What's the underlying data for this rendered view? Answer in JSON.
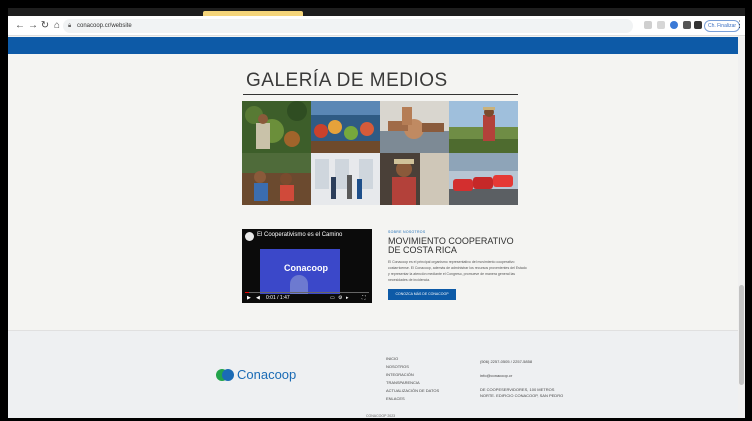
{
  "browser": {
    "url": "conacoop.cr/website",
    "profile_label": "Ch. Finalizar"
  },
  "gallery": {
    "title": "GALERÍA DE MEDIOS"
  },
  "video": {
    "title": "El Cooperativismo es el Camino",
    "logo": "Conacoop",
    "time": "0:01 / 1:47"
  },
  "info": {
    "eyebrow": "SOBRE NOSOTROS",
    "title_line1": "MOVIMIENTO COOPERATIVO",
    "title_line2": "DE COSTA RICA",
    "body": "El Conacoop es el principal organismo representativo del movimiento cooperativo costarricense. El Conacoop, además de administrar los recursos provenientes del Estado y representar la atención mediante el Congreso, promueve de manera general las necesidades de incidencia.",
    "button": "CONOZCA MÁS DE CONACOOP"
  },
  "footer": {
    "logo_text": "Conacoop",
    "links": [
      "INICIO",
      "NOSOTROS",
      "INTEGRACIÓN",
      "TRANSPARENCIA",
      "ACTUALIZACIÓN DE DATOS",
      "ENLACES"
    ],
    "contact": [
      "(506) 2257-0505 / 2257-5858",
      "info@conacoop.cr",
      "DE COOPESERVIDORES, 100 METROS",
      "NORTE. EDIFICIO CONACOOP, SAN PEDRO"
    ],
    "copyright": "CONACOOP 2023"
  }
}
